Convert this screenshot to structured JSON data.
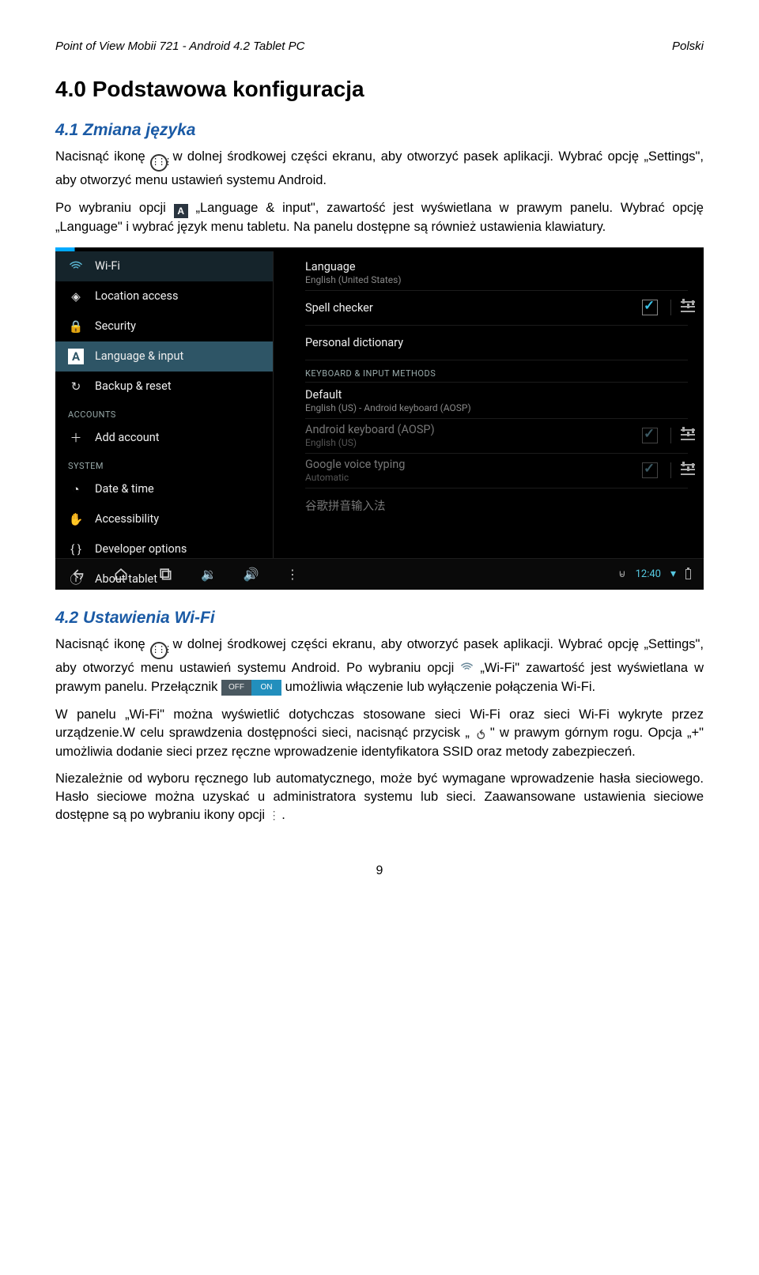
{
  "header": {
    "left": "Point of View Mobii 721 - Android 4.2 Tablet PC",
    "right": "Polski"
  },
  "h1": "4.0 Podstawowa konfiguracja",
  "s41": {
    "title": "4.1 Zmiana języka",
    "p1a": "Nacisnąć ikonę ",
    "p1b": " w dolnej środkowej części ekranu, aby otworzyć pasek aplikacji. Wybrać opcję „Settings\", aby otworzyć menu ustawień systemu Android.",
    "p2a": "Po wybraniu opcji ",
    "p2b": " „Language & input\", zawartość jest wyświetlana w prawym panelu. Wybrać opcję „Language\" i wybrać język menu tabletu. Na panelu dostępne są również ustawienia klawiatury."
  },
  "screenshot": {
    "sidebar": {
      "wifi": "Wi-Fi",
      "location": "Location access",
      "security": "Security",
      "lang": "Language & input",
      "backup": "Backup & reset",
      "accounts_hdr": "ACCOUNTS",
      "addacct": "Add account",
      "system_hdr": "SYSTEM",
      "datetime": "Date & time",
      "access": "Accessibility",
      "dev": "Developer options",
      "about": "About tablet"
    },
    "content": {
      "language": {
        "title": "Language",
        "sub": "English (United States)"
      },
      "spell": {
        "title": "Spell checker"
      },
      "dict": {
        "title": "Personal dictionary"
      },
      "kb_hdr": "KEYBOARD & INPUT METHODS",
      "default": {
        "title": "Default",
        "sub": "English (US) - Android keyboard (AOSP)"
      },
      "akb": {
        "title": "Android keyboard (AOSP)",
        "sub": "English (US)"
      },
      "gvoice": {
        "title": "Google voice typing",
        "sub": "Automatic"
      },
      "pinyin": {
        "title": "谷歌拼音输入法"
      }
    },
    "bar": {
      "time": "12:40"
    }
  },
  "s42": {
    "title": "4.2 Ustawienia Wi-Fi",
    "p1a": "Nacisnąć ikonę ",
    "p1b": " w dolnej środkowej części ekranu, aby otworzyć pasek aplikacji. Wybrać opcję „Settings\", aby otworzyć menu ustawień systemu Android. Po wybraniu opcji ",
    "p1c": " „Wi-Fi\" zawartość jest wyświetlana w prawym panelu. Przełącznik ",
    "p1d": " umożliwia włączenie lub wyłączenie połączenia Wi-Fi.",
    "toggle": {
      "off": "OFF",
      "on": "ON"
    },
    "p2a": "W panelu „Wi-Fi\" można wyświetlić dotychczas stosowane sieci Wi-Fi oraz sieci Wi-Fi wykryte przez urządzenie.W celu sprawdzenia dostępności sieci, nacisnąć przycisk „",
    "p2b": "\" w prawym górnym rogu. Opcja „+\" umożliwia dodanie sieci przez ręczne wprowadzenie identyfikatora SSID oraz metody zabezpieczeń.",
    "p3a": "Niezależnie od wyboru ręcznego lub automatycznego, może być wymagane  wprowadzenie hasła sieciowego. Hasło sieciowe można uzyskać u administratora systemu lub sieci. Zaawansowane ustawienia sieciowe dostępne są po wybraniu ikony opcji ",
    "p3b": "."
  },
  "page_number": "9"
}
